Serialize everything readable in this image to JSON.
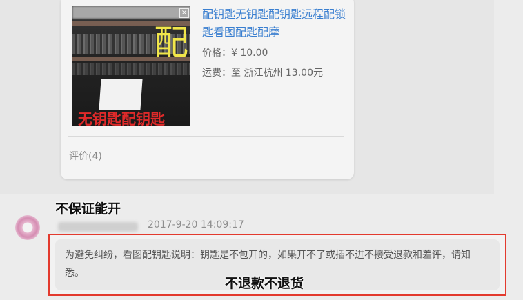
{
  "product_card": {
    "image": {
      "overlay_char": "配",
      "caption": "无钥匙配钥匙"
    },
    "title": "配钥匙无钥匙配钥匙远程配锁匙看图配匙配摩",
    "price_label": "价格：",
    "price_value": "¥ 10.00",
    "shipping_label": "运费：",
    "shipping_value": "至 浙江杭州 13.00元",
    "reviews": "评价(4)"
  },
  "comment": {
    "annotation_top": "不保证能开",
    "timestamp": "2017-9-20 14:09:17",
    "message": "为避免纠纷，看图配钥匙说明：钥匙是不包开的，如果开不了或插不进不接受退款和差评，请知悉。",
    "annotation_bottom": "不退款不退货"
  },
  "colors": {
    "title_blue": "#3a7fd0",
    "highlight_red": "#e33a2e",
    "caption_red": "#e02a2a",
    "overlay_yellow": "#f1e64a"
  }
}
